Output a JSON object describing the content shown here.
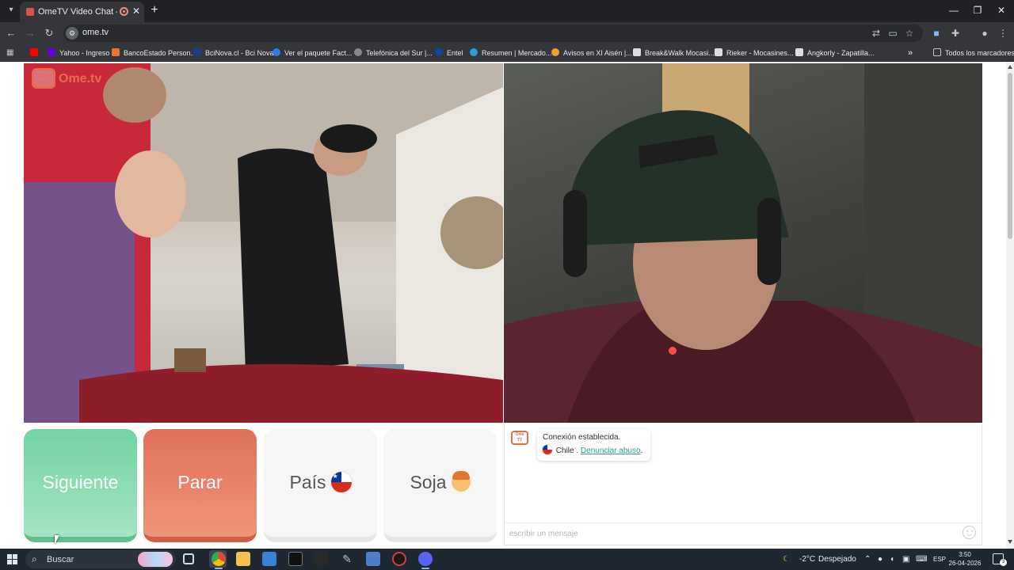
{
  "browser": {
    "tab_title": "OmeTV Video Chat — Alte",
    "tab_close": "✕",
    "new_tab": "+",
    "url": "ome.tv",
    "window_minimize": "—",
    "window_restore": "❐",
    "window_close": "✕"
  },
  "bookmarks": {
    "items": [
      {
        "label": "Yahoo - Ingreso",
        "color": "#6001d2"
      },
      {
        "label": "BancoEstado Person...",
        "color": "#e8772e"
      },
      {
        "label": "BciNova.cl - Bci Nova",
        "color": "#1b3c87"
      },
      {
        "label": "Ver el paquete Fact...",
        "color": "#2a7de1"
      },
      {
        "label": "Telefónica del Sur |...",
        "color": "#888888"
      },
      {
        "label": "Entel",
        "color": "#0c47a1"
      },
      {
        "label": "Resumen | Mercado...",
        "color": "#2d9cdb"
      },
      {
        "label": "Avisos en XI Aisén |...",
        "color": "#f0a030"
      },
      {
        "label": "Break&Walk Mocasi...",
        "color": "#dddddd"
      },
      {
        "label": "Rieker - Mocasines...",
        "color": "#dddddd"
      },
      {
        "label": "Angkorly - Zapatilla...",
        "color": "#dddddd"
      }
    ],
    "overflow": "»",
    "all_bookmarks": "Todos los marcadores"
  },
  "page": {
    "logo_box": "Ome TV",
    "logo_text": "Ome.tv",
    "buttons": {
      "next": "Siguiente",
      "stop": "Parar",
      "country": "País",
      "gender": "Soja"
    },
    "chat": {
      "avatar": "Ome TV",
      "connection_message": "Conexión establecida.",
      "country_name": "Chile",
      "separator": ".",
      "report_link": "Denunciar abuso",
      "report_end": ".",
      "input_placeholder": "escribir un mensaje"
    }
  },
  "taskbar": {
    "search_label": "Buscar",
    "weather_temp": "-2°C",
    "weather_text": "Despejado",
    "language": "ESP",
    "time": "3:50",
    "date": "26-04-2026",
    "notification_count": "3"
  },
  "colors": {
    "next_button": "#72d3a1",
    "stop_button": "#e0705a",
    "brand_accent": "#e86a4f",
    "link": "#2a9d8f"
  }
}
